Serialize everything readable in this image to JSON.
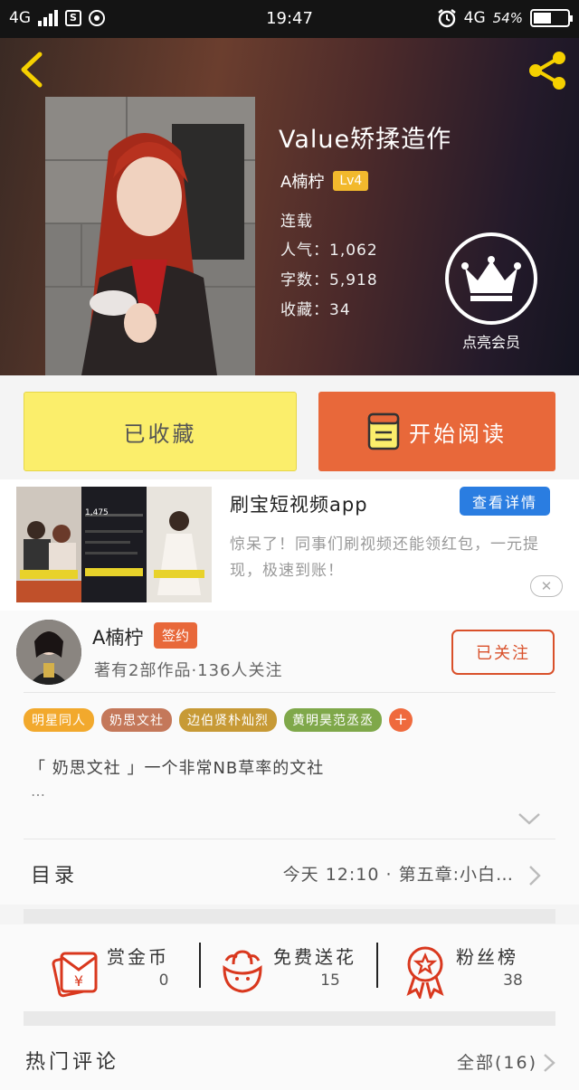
{
  "status_bar": {
    "network_left": "4G",
    "time": "19:47",
    "network_right": "4G",
    "battery": "54%",
    "battery_level": 0.54
  },
  "book": {
    "title": "Value矫揉造作",
    "author": "A楠柠",
    "level": "Lv4",
    "status": "连载",
    "popularity": "人气：1,062",
    "word_count": "字数：5,918",
    "collections": "收藏：34"
  },
  "vip": {
    "label": "点亮会员"
  },
  "actions": {
    "favorited_label": "已收藏",
    "read_label": "开始阅读"
  },
  "ad": {
    "title": "刷宝短视频app",
    "button": "查看详情",
    "description": "惊呆了！同事们刷视频还能领红包，一元提现，极速到账！",
    "close": "✕",
    "thumb_count": "1,475"
  },
  "author_section": {
    "name": "A楠柠",
    "badge": "签约",
    "info": "著有2部作品·136人关注",
    "follow_label": "已关注"
  },
  "tags": [
    {
      "label": "明星同人",
      "color": "#f2a92d"
    },
    {
      "label": "奶思文社",
      "color": "#c4785a"
    },
    {
      "label": "边伯贤朴灿烈",
      "color": "#c79a36"
    },
    {
      "label": "黄明昊范丞丞",
      "color": "#7fa84a"
    }
  ],
  "tag_more": "+",
  "intro": {
    "text": "「 奶思文社 」一个非常NB草率的文社",
    "more": "…"
  },
  "toc": {
    "label": "目录",
    "latest": "今天 12:10 · 第五章:小白…"
  },
  "stats": [
    {
      "label": "赏金币",
      "value": "0",
      "icon": "red-envelope-icon"
    },
    {
      "label": "免费送花",
      "value": "15",
      "icon": "flower-icon"
    },
    {
      "label": "粉丝榜",
      "value": "38",
      "icon": "medal-icon"
    }
  ],
  "comments": {
    "title": "热门评论",
    "all_label": "全部(16)"
  },
  "colors": {
    "accent": "#e8683a",
    "favorite": "#fbee6b",
    "share": "#f5d000",
    "ad_button": "#2a7de1"
  }
}
